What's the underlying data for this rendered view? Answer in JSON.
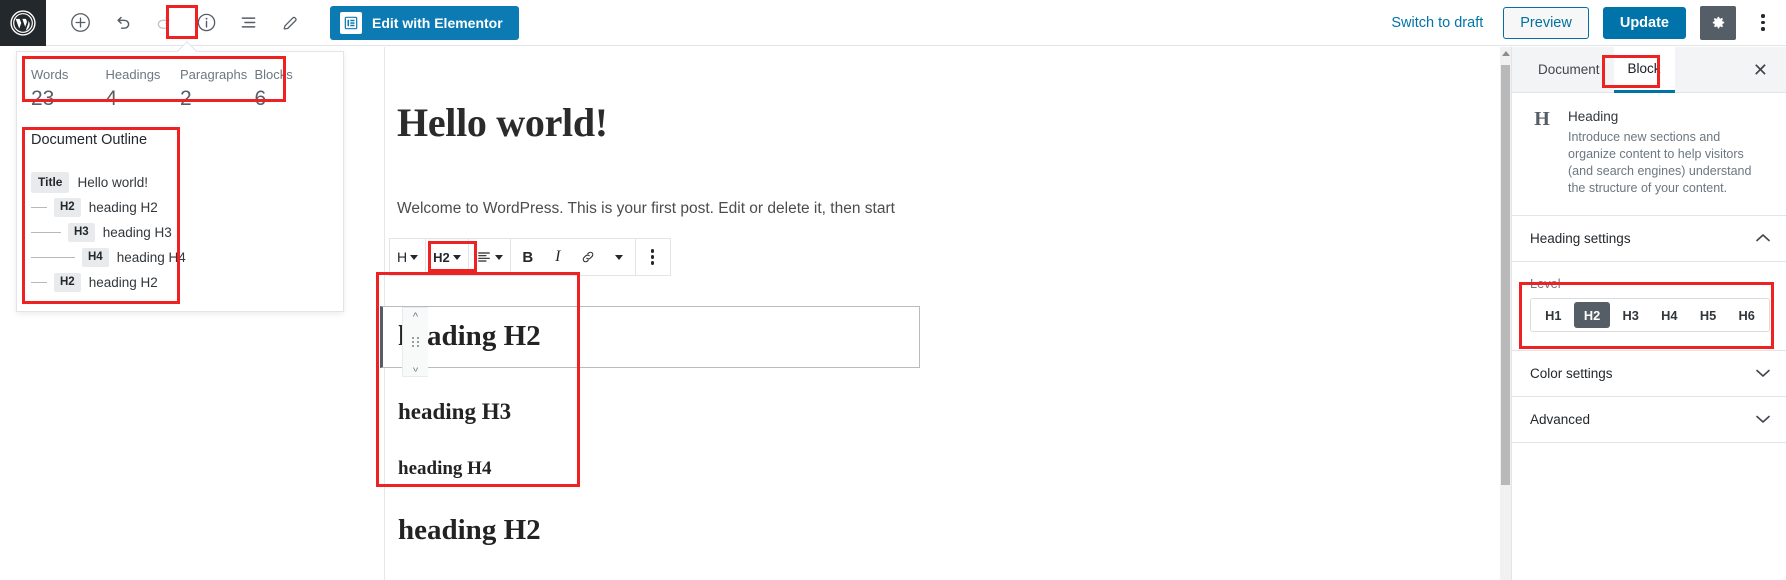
{
  "topbar": {
    "logo_icon": "wordpress-logo-icon",
    "tools": [
      {
        "name": "add-block-button",
        "icon": "plus-circle-icon",
        "label": "",
        "disabled": false
      },
      {
        "name": "undo-button",
        "icon": "undo-arrow-icon",
        "label": "",
        "disabled": false
      },
      {
        "name": "redo-button",
        "icon": "redo-arrow-icon",
        "label": "",
        "disabled": true
      },
      {
        "name": "content-structure-button",
        "icon": "info-circle-icon",
        "label": "",
        "disabled": false
      },
      {
        "name": "block-navigation-button",
        "icon": "list-view-icon",
        "label": "",
        "disabled": false
      },
      {
        "name": "edit-mode-button",
        "icon": "pencil-icon",
        "label": "",
        "disabled": false
      }
    ],
    "elementor_button_label": "Edit with Elementor",
    "elementor_button_color": "#0c7bb3",
    "switch_to_draft_label": "Switch to draft",
    "preview_label": "Preview",
    "update_label": "Update",
    "update_color": "#0073aa",
    "settings_icon": "gear-icon",
    "more_icon": "kebab-menu-icon"
  },
  "structure_popover": {
    "counts": [
      {
        "label": "Words",
        "value": "23"
      },
      {
        "label": "Headings",
        "value": "4"
      },
      {
        "label": "Paragraphs",
        "value": "2"
      },
      {
        "label": "Blocks",
        "value": "6"
      }
    ],
    "outline_title": "Document Outline",
    "outline_items": [
      {
        "badge": "Title",
        "text": "Hello world!",
        "indent": 0
      },
      {
        "badge": "H2",
        "text": "heading H2",
        "indent": 1
      },
      {
        "badge": "H3",
        "text": "heading H3",
        "indent": 2
      },
      {
        "badge": "H4",
        "text": "heading H4",
        "indent": 3
      },
      {
        "badge": "H2",
        "text": "heading H2",
        "indent": 1
      }
    ]
  },
  "editor": {
    "post_title": "Hello world!",
    "paragraph": "Welcome to WordPress. This is your first post. Edit or delete it, then start",
    "block_toolbar": {
      "block_type_label": "H",
      "heading_level_label": "H2",
      "align_icon": "align-left-icon",
      "bold_label": "B",
      "italic_label": "I",
      "link_icon": "link-icon",
      "more_rich_text_icon": "chevron-down-icon",
      "block_options_icon": "kebab-menu-icon"
    },
    "mover": {
      "up_icon": "chevron-up-icon",
      "drag_icon": "drag-handle-icon",
      "down_icon": "chevron-down-icon"
    },
    "headings": [
      {
        "text": "heading H2",
        "level": "h2"
      },
      {
        "text": "heading H3",
        "level": "h3"
      },
      {
        "text": "heading H4",
        "level": "h4"
      },
      {
        "text": "heading H2",
        "level": "h2"
      }
    ]
  },
  "sidebar": {
    "tabs": [
      {
        "label": "Document",
        "active": false
      },
      {
        "label": "Block",
        "active": true
      }
    ],
    "close_icon": "close-icon",
    "close_label": "✕",
    "block_card": {
      "icon_letter": "H",
      "name": "Heading",
      "description": "Introduce new sections and organize content to help visitors (and search engines) understand the structure of your content."
    },
    "panels": [
      {
        "name": "heading-settings",
        "title": "Heading settings",
        "expanded": true,
        "chevron": "⌃"
      },
      {
        "name": "color-settings",
        "title": "Color settings",
        "expanded": false,
        "chevron": "⌄"
      },
      {
        "name": "advanced",
        "title": "Advanced",
        "expanded": false,
        "chevron": "⌄"
      }
    ],
    "level_label": "Level",
    "levels": [
      {
        "label": "H1",
        "active": false
      },
      {
        "label": "H2",
        "active": true
      },
      {
        "label": "H3",
        "active": false
      },
      {
        "label": "H4",
        "active": false
      },
      {
        "label": "H5",
        "active": false
      },
      {
        "label": "H6",
        "active": false
      }
    ]
  },
  "highlights": {
    "color": "#ee2222",
    "regions": [
      "info-button-highlight",
      "counts-highlight",
      "outline-highlight",
      "heading-level-toolbar-highlight",
      "heading-blocks-highlight",
      "block-tab-highlight",
      "level-setting-highlight"
    ]
  }
}
